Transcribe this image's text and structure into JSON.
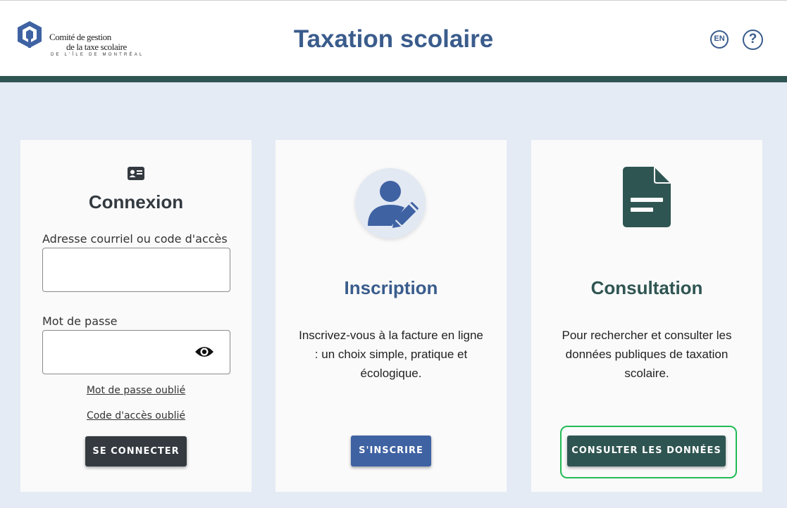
{
  "header": {
    "logo": {
      "line1": "Comité de gestion",
      "line2": "de la taxe scolaire",
      "line3": "DE L'ÎLE DE MONTRÉAL"
    },
    "title": "Taxation scolaire",
    "lang_label": "EN",
    "help_label": "?"
  },
  "login": {
    "title": "Connexion",
    "email_label": "Adresse courriel ou code d'accès",
    "email_value": "",
    "password_label": "Mot de passe",
    "password_value": "",
    "forgot_password": "Mot de passe oublié",
    "forgot_code": "Code d'accès oublié",
    "submit": "SE CONNECTER"
  },
  "inscription": {
    "title": "Inscription",
    "description": "Inscrivez-vous à la facture en ligne : un choix simple, pratique et écologique.",
    "button": "S'INSCRIRE"
  },
  "consultation": {
    "title": "Consultation",
    "description": "Pour rechercher et consulter les données publiques de taxation scolaire.",
    "button": "CONSULTER LES DONNÉES"
  },
  "colors": {
    "primary_blue": "#3a5c8c",
    "dark_green": "#2f5552",
    "button_dark": "#343a40",
    "button_blue": "#3f62a3",
    "focus_outline": "#22bb55",
    "page_background": "#e4ebf5"
  }
}
